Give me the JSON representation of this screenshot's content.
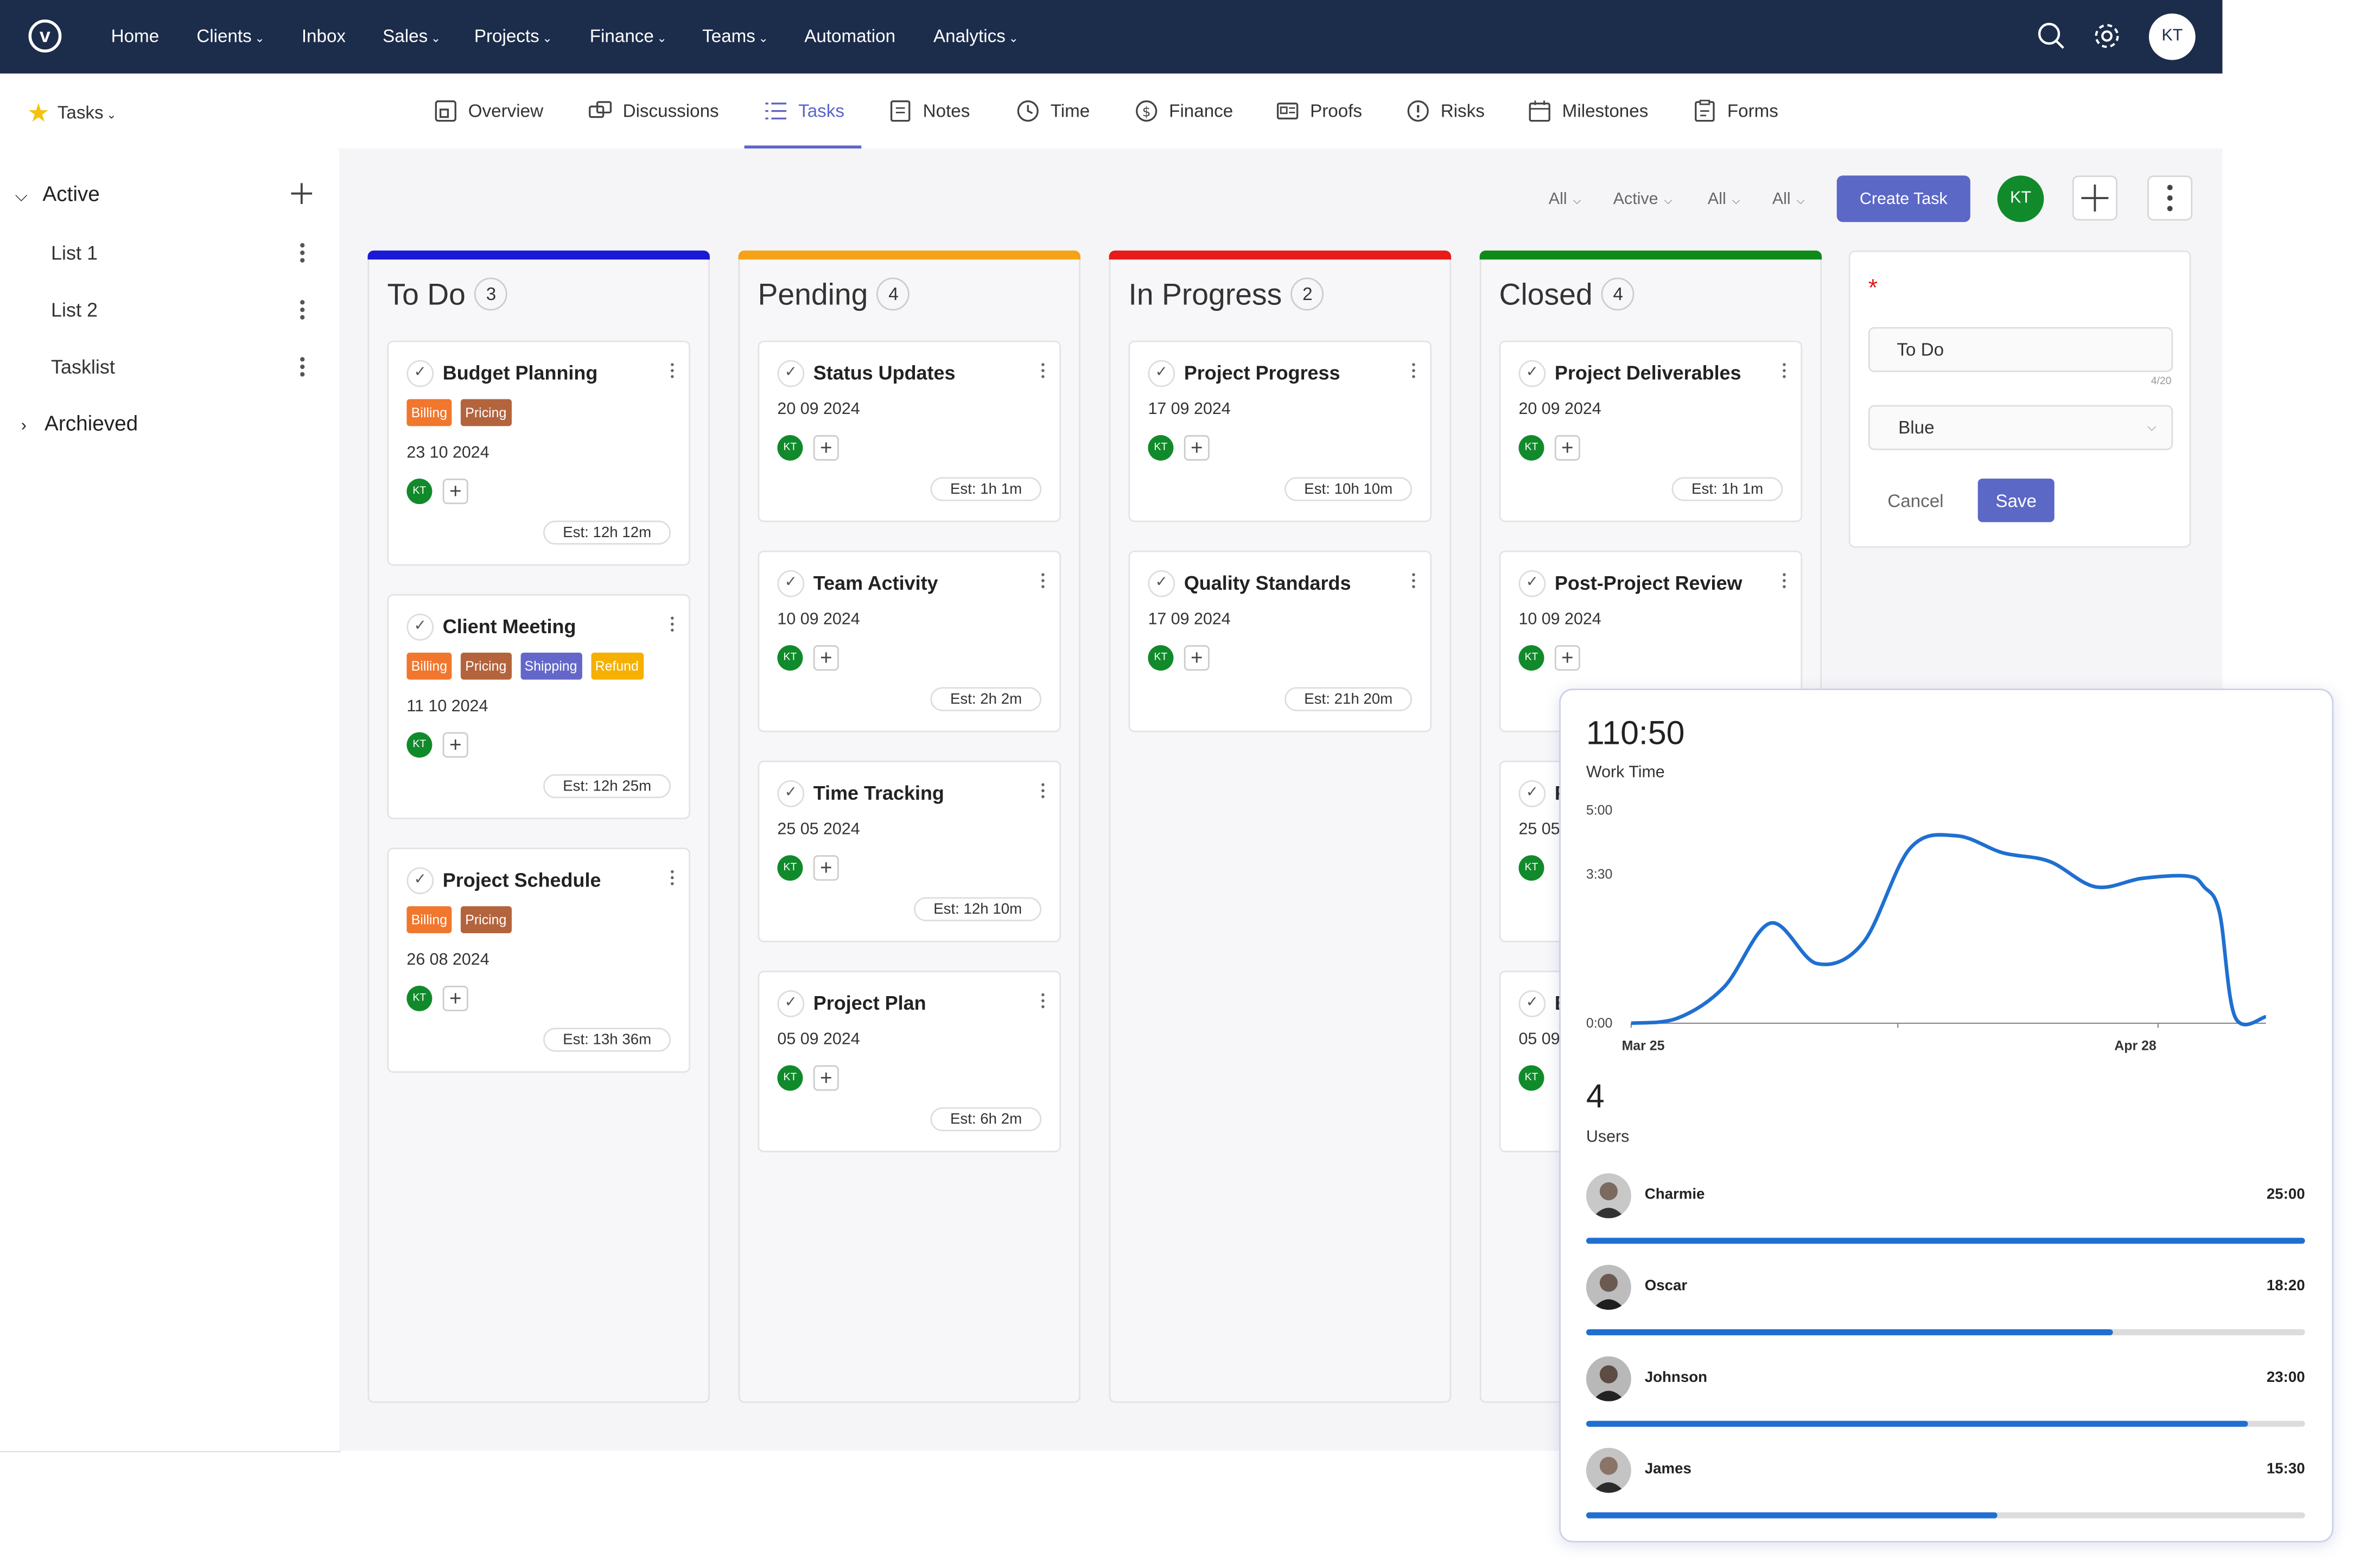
{
  "nav": {
    "logo": "v",
    "items": [
      "Home",
      "Clients",
      "Inbox",
      "Sales",
      "Projects",
      "Finance",
      "Teams",
      "Automation",
      "Analytics"
    ],
    "avatar": "KT"
  },
  "subnav": {
    "project": "Tasks",
    "tabs": [
      "Overview",
      "Discussions",
      "Tasks",
      "Notes",
      "Time",
      "Finance",
      "Proofs",
      "Risks",
      "Milestones",
      "Forms"
    ]
  },
  "sidebar": {
    "active": "Active",
    "lists": [
      "List 1",
      "List 2",
      "Tasklist"
    ],
    "archived": "Archieved"
  },
  "filters": [
    "All",
    "Active",
    "All",
    "All"
  ],
  "toolbar": {
    "create_task": "Create Task",
    "avatar": "KT"
  },
  "colors": {
    "todo": "#1a1ad6",
    "pending": "#f5a316",
    "in_progress": "#e81b1b",
    "closed": "#0e8a18",
    "accent": "#5c68c6",
    "billing": "#f0772d",
    "pricing": "#b3643d",
    "shipping": "#6467c9",
    "refund": "#f5b000"
  },
  "columns": [
    {
      "title": "To Do",
      "count": "3",
      "cards": [
        {
          "title": "Budget Planning",
          "tags": [
            "Billing",
            "Pricing"
          ],
          "date": "23 10 2024",
          "user": "KT",
          "est": "Est: 12h 12m"
        },
        {
          "title": "Client Meeting",
          "tags": [
            "Billing",
            "Pricing",
            "Shipping",
            "Refund"
          ],
          "date": "11 10 2024",
          "user": "KT",
          "est": "Est: 12h 25m"
        },
        {
          "title": "Project Schedule",
          "tags": [
            "Billing",
            "Pricing"
          ],
          "date": "26 08 2024",
          "user": "KT",
          "est": "Est: 13h 36m"
        }
      ]
    },
    {
      "title": "Pending",
      "count": "4",
      "cards": [
        {
          "title": "Status Updates",
          "date": "20 09 2024",
          "user": "KT",
          "est": "Est: 1h 1m"
        },
        {
          "title": "Team Activity",
          "date": "10 09 2024",
          "user": "KT",
          "est": "Est: 2h 2m"
        },
        {
          "title": "Time Tracking",
          "date": "25 05 2024",
          "user": "KT",
          "est": "Est: 12h 10m"
        },
        {
          "title": "Project Plan",
          "date": "05 09 2024",
          "user": "KT",
          "est": "Est: 6h 2m"
        }
      ]
    },
    {
      "title": "In Progress",
      "count": "2",
      "cards": [
        {
          "title": "Project Progress",
          "date": "17 09 2024",
          "user": "KT",
          "est": "Est: 10h 10m"
        },
        {
          "title": "Quality Standards",
          "date": "17 09 2024",
          "user": "KT",
          "est": "Est: 21h 20m"
        }
      ]
    },
    {
      "title": "Closed",
      "count": "4",
      "cards": [
        {
          "title": "Project Deliverables",
          "date": "20 09 2024",
          "user": "KT",
          "est": "Est: 1h 1m"
        },
        {
          "title": "Post-Project Review",
          "date": "10 09 2024",
          "user": "KT",
          "est": ""
        },
        {
          "title": "P",
          "date": "25 05",
          "user": "KT",
          "est": ""
        },
        {
          "title": "E",
          "date": "05 09",
          "user": "KT",
          "est": ""
        }
      ]
    }
  ],
  "new_list": {
    "required_mark": "*",
    "name_value": "To Do",
    "char_count": "4/20",
    "color_value": "Blue",
    "cancel": "Cancel",
    "save": "Save"
  },
  "work_time": {
    "total": "110:50",
    "label": "Work Time",
    "users_count": "4",
    "users_label": "Users",
    "users": [
      {
        "name": "Charmie",
        "time": "25:00",
        "progress": 1.0
      },
      {
        "name": "Oscar",
        "time": "18:20",
        "progress": 0.733
      },
      {
        "name": "Johnson",
        "time": "23:00",
        "progress": 0.92
      },
      {
        "name": "James",
        "time": "15:30",
        "progress": 0.573
      }
    ]
  },
  "chart_data": {
    "type": "area",
    "yticks": [
      "5:00",
      "3:30",
      "0:00"
    ],
    "xticks": [
      "Mar 25",
      "Apr 28"
    ],
    "ylim": [
      0,
      5
    ],
    "series": [
      {
        "values": [
          [
            0,
            0.0
          ],
          [
            3,
            0.12
          ],
          [
            6,
            0.85
          ],
          [
            9,
            2.35
          ],
          [
            12,
            1.4
          ],
          [
            15,
            1.9
          ],
          [
            18,
            4.1
          ],
          [
            21,
            4.4
          ],
          [
            24,
            4.0
          ],
          [
            27,
            3.8
          ],
          [
            30,
            3.2
          ],
          [
            33,
            3.4
          ],
          [
            36,
            3.45
          ],
          [
            37,
            3.2
          ],
          [
            38,
            2.6
          ],
          [
            39,
            0.15
          ],
          [
            41,
            0.15
          ]
        ]
      }
    ],
    "line_color": "#1f6fd1",
    "grid": false
  }
}
